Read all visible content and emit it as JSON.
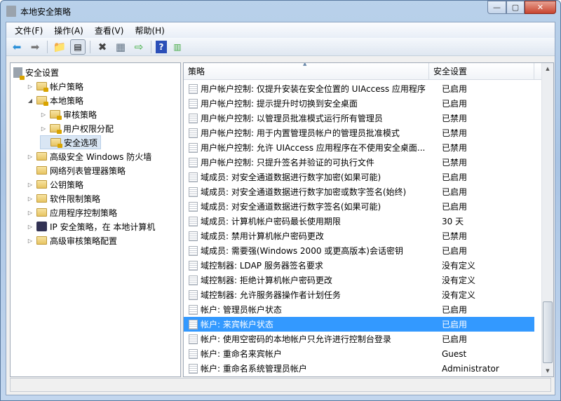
{
  "window": {
    "title": "本地安全策略",
    "min": "—",
    "max": "▢",
    "close": "✕"
  },
  "menu": [
    "文件(F)",
    "操作(A)",
    "查看(V)",
    "帮助(H)"
  ],
  "tree": [
    {
      "label": "安全设置",
      "level": 0,
      "expand": "",
      "icon": "lock"
    },
    {
      "label": "帐户策略",
      "level": 1,
      "expand": "▷",
      "icon": "lockfolder"
    },
    {
      "label": "本地策略",
      "level": 1,
      "expand": "◢",
      "icon": "lockfolder"
    },
    {
      "label": "审核策略",
      "level": 2,
      "expand": "▷",
      "icon": "lockfolder"
    },
    {
      "label": "用户权限分配",
      "level": 2,
      "expand": "▷",
      "icon": "lockfolder"
    },
    {
      "label": "安全选项",
      "level": 2,
      "expand": "",
      "icon": "lockfolder",
      "selected": true
    },
    {
      "label": "高级安全 Windows 防火墙",
      "level": 1,
      "expand": "▷",
      "icon": "folder"
    },
    {
      "label": "网络列表管理器策略",
      "level": 1,
      "expand": "",
      "icon": "folder"
    },
    {
      "label": "公钥策略",
      "level": 1,
      "expand": "▷",
      "icon": "folder"
    },
    {
      "label": "软件限制策略",
      "level": 1,
      "expand": "▷",
      "icon": "folder"
    },
    {
      "label": "应用程序控制策略",
      "level": 1,
      "expand": "▷",
      "icon": "folder"
    },
    {
      "label": "IP 安全策略，在 本地计算机",
      "level": 1,
      "expand": "▷",
      "icon": "ipsec"
    },
    {
      "label": "高级审核策略配置",
      "level": 1,
      "expand": "▷",
      "icon": "folder"
    }
  ],
  "list": {
    "columns": [
      "策略",
      "安全设置"
    ],
    "sort_indicator": "▲",
    "rows": [
      [
        "用户帐户控制: 仅提升安装在安全位置的 UIAccess 应用程序",
        "已启用"
      ],
      [
        "用户帐户控制: 提示提升时切换到安全桌面",
        "已启用"
      ],
      [
        "用户帐户控制: 以管理员批准模式运行所有管理员",
        "已禁用"
      ],
      [
        "用户帐户控制: 用于内置管理员帐户的管理员批准模式",
        "已禁用"
      ],
      [
        "用户帐户控制: 允许 UIAccess 应用程序在不使用安全桌面...",
        "已禁用"
      ],
      [
        "用户帐户控制: 只提升签名并验证的可执行文件",
        "已禁用"
      ],
      [
        "域成员: 对安全通道数据进行数字加密(如果可能)",
        "已启用"
      ],
      [
        "域成员: 对安全通道数据进行数字加密或数字签名(始终)",
        "已启用"
      ],
      [
        "域成员: 对安全通道数据进行数字签名(如果可能)",
        "已启用"
      ],
      [
        "域成员: 计算机帐户密码最长使用期限",
        "30 天"
      ],
      [
        "域成员: 禁用计算机帐户密码更改",
        "已禁用"
      ],
      [
        "域成员: 需要强(Windows 2000 或更高版本)会话密钥",
        "已启用"
      ],
      [
        "域控制器: LDAP 服务器签名要求",
        "没有定义"
      ],
      [
        "域控制器: 拒绝计算机帐户密码更改",
        "没有定义"
      ],
      [
        "域控制器: 允许服务器操作者计划任务",
        "没有定义"
      ],
      [
        "帐户: 管理员帐户状态",
        "已启用"
      ],
      [
        "帐户: 来宾帐户状态",
        "已启用"
      ],
      [
        "帐户: 使用空密码的本地帐户只允许进行控制台登录",
        "已启用"
      ],
      [
        "帐户: 重命名来宾帐户",
        "Guest"
      ],
      [
        "帐户: 重命名系统管理员帐户",
        "Administrator"
      ]
    ],
    "selected_index": 16
  }
}
